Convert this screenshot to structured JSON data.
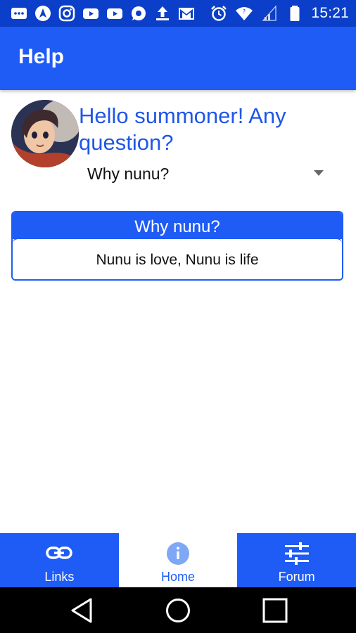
{
  "status_bar": {
    "time": "15:21",
    "left_icons": [
      "messages-icon",
      "maps-icon",
      "instagram-icon",
      "youtube-icon",
      "youtube-icon",
      "whatsapp-icon",
      "upload-icon",
      "gmail-icon"
    ],
    "right_icons": [
      "alarm-icon",
      "wifi-icon",
      "signal-icon",
      "battery-icon"
    ]
  },
  "app_bar": {
    "title": "Help"
  },
  "greeting": "Hello summoner! Any question?",
  "question_select": {
    "selected": "Why nunu?"
  },
  "answer_card": {
    "title": "Why nunu?",
    "body": "Nunu is love, Nunu is life"
  },
  "bottom_nav": {
    "items": [
      {
        "label": "Links",
        "icon": "link-icon",
        "active": false
      },
      {
        "label": "Home",
        "icon": "info-icon",
        "active": true
      },
      {
        "label": "Forum",
        "icon": "sliders-icon",
        "active": false
      }
    ]
  },
  "system_nav": {
    "buttons": [
      "back-icon",
      "home-icon",
      "recents-icon"
    ]
  },
  "colors": {
    "status_bar": "#0b3fc9",
    "primary": "#1f5cf5",
    "greeting_text": "#1f56e8",
    "system_nav": "#000000"
  }
}
